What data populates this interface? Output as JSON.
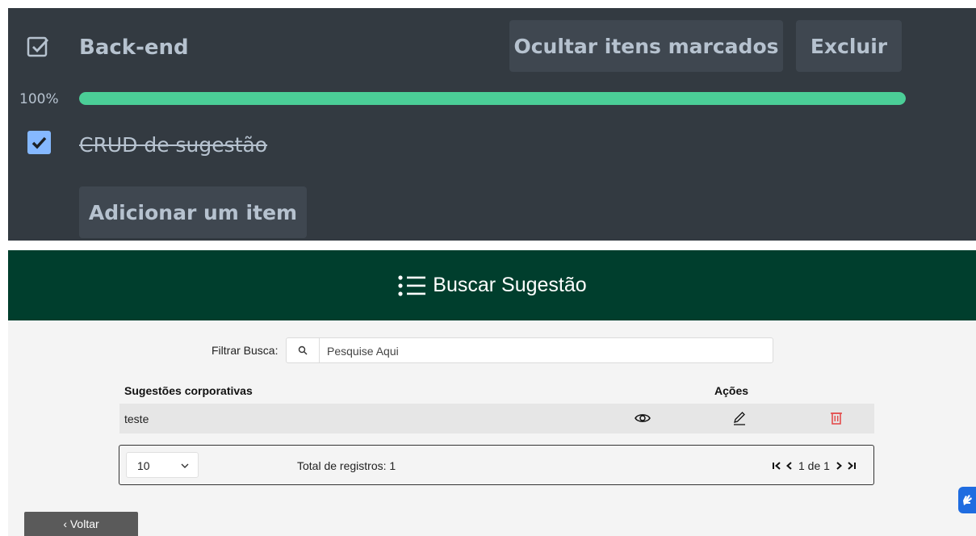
{
  "checklist": {
    "title": "Back-end",
    "hide_checked_label": "Ocultar itens marcados",
    "delete_label": "Excluir",
    "progress_label": "100%",
    "progress_fraction": 1.0,
    "item": {
      "label": "CRUD de sugestão",
      "checked": true
    },
    "add_item_label": "Adicionar um item"
  },
  "header": {
    "title": "Buscar Sugestão"
  },
  "filter": {
    "label": "Filtrar Busca:",
    "placeholder": "Pesquise Aqui",
    "value": ""
  },
  "table": {
    "headers": {
      "name": "Sugestões corporativas",
      "actions": "Ações"
    },
    "rows": [
      {
        "name": "teste"
      }
    ]
  },
  "pagination": {
    "page_size": "10",
    "total_label": "Total de registros: 1",
    "page_info": "1 de 1"
  },
  "back_button": {
    "label": "‹ Voltar"
  },
  "colors": {
    "panel_dark": "#333a41",
    "progress_green": "#4bce97",
    "header_green": "#003e2d",
    "delete_red": "#e34c4c",
    "checkbox_blue": "#85b8ff"
  },
  "icons": {
    "checklist": "checklist-icon",
    "list": "list-icon",
    "search": "search-icon",
    "view": "eye-icon",
    "edit": "pencil-icon",
    "delete": "trash-icon",
    "accessibility": "sign-language-icon"
  }
}
